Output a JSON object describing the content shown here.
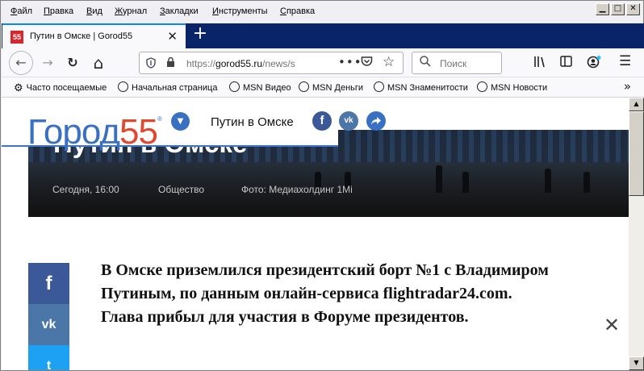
{
  "menubar": {
    "items": [
      "Файл",
      "Правка",
      "Вид",
      "Журнал",
      "Закладки",
      "Инструменты",
      "Справка"
    ],
    "underline": [
      "Ф",
      "П",
      "В",
      "Ж",
      "З",
      "И",
      "С"
    ]
  },
  "window_controls": {
    "minimize": "▁",
    "maximize": "□",
    "close": "✕"
  },
  "tab": {
    "title": "Путин в Омске | Gorod55",
    "favicon": "55",
    "close": "✕"
  },
  "new_tab": "+",
  "nav": {
    "back_icon": "←",
    "forward_icon": "→",
    "reload_icon": "↻",
    "home_icon": "⌂",
    "url_prefix": "https://",
    "url_domain": "gorod55.ru",
    "url_path": "/news/s",
    "dots": "•••",
    "search_placeholder": "Поиск"
  },
  "bookmarks": [
    "Часто посещаемые",
    "Начальная страница",
    "MSN Видео",
    "MSN Деньги",
    "MSN Знаменитости",
    "MSN Новости"
  ],
  "bookmarks_more": "»",
  "site": {
    "logo_part1": "Город",
    "logo_part2": "55",
    "logo_reg": "®",
    "header_title": "Путин в Омске",
    "brand_blue": "#3a70c2",
    "brand_red": "#e2472f"
  },
  "article": {
    "title": "Путин в Омске",
    "date": "Сегодня, 16:00",
    "rubric": "Общество",
    "photo_credit": "Фото: Медиахолдинг 1Mi",
    "lead": "В Омске приземлился президентский борт №1 с Владимиром Путиным, по данным онлайн-сервиса flightradar24.com. Глава прибыл для участия в Форуме президентов."
  },
  "social": {
    "fb": "f",
    "vk": "vk",
    "tw": "t"
  },
  "close_icon": "✕"
}
